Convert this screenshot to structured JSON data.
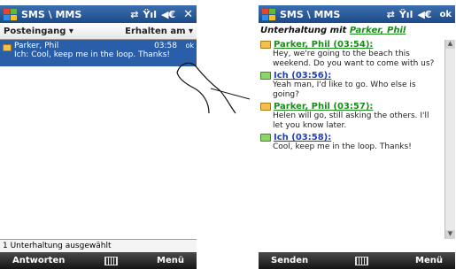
{
  "left": {
    "title": "SMS \\ MMS",
    "header": {
      "folder": "Posteingang ▾",
      "sort": "Erhalten am ▾"
    },
    "message": {
      "sender": "Parker, Phil",
      "time": "03:58",
      "ok": "ok",
      "preview": "Ich: Cool, keep me in the loop. Thanks!"
    },
    "status": "1 Unterhaltung ausgewählt",
    "softkeys": {
      "left": "Antworten",
      "right": "Menü"
    }
  },
  "right": {
    "title": "SMS \\ MMS",
    "ok": "ok",
    "conversation_label": "Unterhaltung mit",
    "conversation_with": "Parker, Phil",
    "messages": [
      {
        "head": "Parker, Phil (03:54):",
        "text": "Hey, we're going to the beach this weekend. Do you want to come with us?"
      },
      {
        "head": "Ich (03:56):",
        "text": "Yeah man, I'd like to go. Who else is going?"
      },
      {
        "head": "Parker, Phil (03:57):",
        "text": "Helen will go, still asking the others. I'll let you know later."
      },
      {
        "head": "Ich (03:58):",
        "text": "Cool, keep me in the loop. Thanks!"
      }
    ],
    "softkeys": {
      "left": "Senden",
      "right": "Menü"
    }
  },
  "icons": {
    "start": "windows-start-icon",
    "signal": "signal-icon",
    "volume": "volume-icon",
    "connection": "connection-icon",
    "keyboard": "keyboard-icon"
  }
}
